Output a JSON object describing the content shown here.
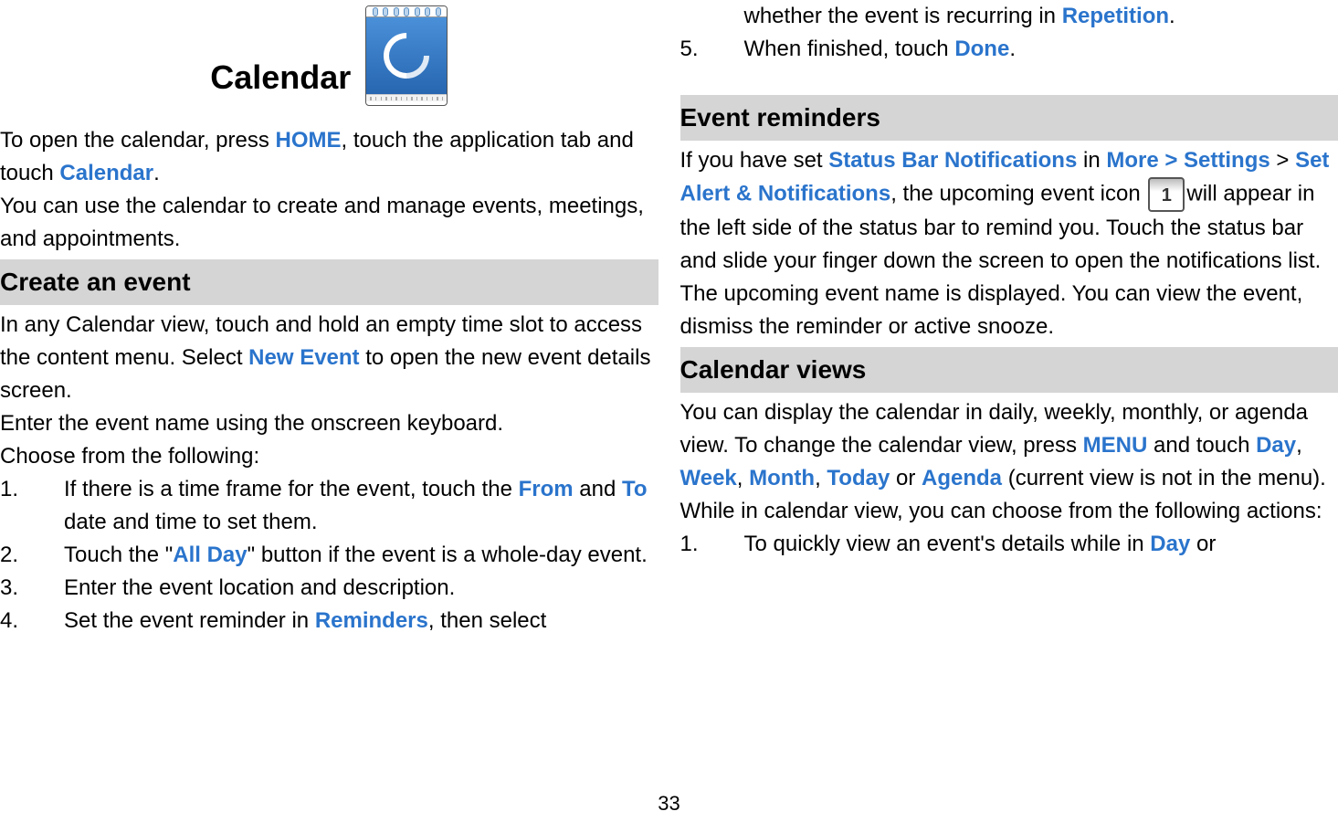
{
  "page_number": "33",
  "left": {
    "title": "Calendar",
    "intro1_pre": "To open the calendar, press ",
    "intro1_home": "HOME",
    "intro1_mid": ", touch the application tab and touch ",
    "intro1_calendar": "Calendar",
    "intro1_end": ".",
    "intro2": "You can use the calendar to create and manage events, meetings, and appointments.",
    "section1_title": "Create an event",
    "section1_p1_pre": "In any Calendar view, touch and hold an empty time slot to access the content menu.    Select ",
    "section1_p1_newevent": "New Event",
    "section1_p1_post": " to open the new event details screen.",
    "section1_p2": "Enter the event name using the onscreen keyboard.",
    "section1_p3": "Choose from the following:",
    "li1_pre": "If there is a time frame for the event, touch the ",
    "li1_from": "From",
    "li1_and": " and ",
    "li1_to": "To",
    "li1_post": " date and time to set them.",
    "li2_pre": "Touch the \"",
    "li2_allday": "All Day",
    "li2_post": "\" button if the event is a whole-day event.",
    "li3": "Enter the event location and description.",
    "li4_pre": "Set the event reminder in ",
    "li4_rem": "Reminders",
    "li4_post": ", then select "
  },
  "right": {
    "li4_cont_pre": "whether the event is recurring in ",
    "li4_cont_rep": "Repetition",
    "li4_cont_end": ".",
    "li5_pre": "When finished, touch ",
    "li5_done": "Done",
    "li5_end": ".",
    "section2_title": "Event reminders",
    "s2_p1_pre": "If you have set ",
    "s2_p1_sbn": "Status Bar Notifications",
    "s2_p1_in": " in ",
    "s2_p1_more": "More > Settings",
    "s2_p1_gt": " > ",
    "s2_p1_san": "Set Alert & Notifications",
    "s2_p1_mid1": ", the upcoming event icon ",
    "s2_p1_iconnum": "1",
    "s2_p1_post": "will appear in the left side of the status bar to remind you. Touch the status bar and slide your finger down the screen to open the notifications list. The upcoming event name is displayed. You can view the event, dismiss the reminder or active snooze.",
    "section3_title": "Calendar views",
    "s3_p1_pre": "You can display the calendar in daily, weekly, monthly, or agenda view. To change the calendar view, press ",
    "s3_p1_menu": "MENU",
    "s3_p1_andtouch": " and touch ",
    "s3_p1_day": "Day",
    "s3_p1_c1": ", ",
    "s3_p1_week": "Week",
    "s3_p1_c2": ", ",
    "s3_p1_month": "Month",
    "s3_p1_c3": ", ",
    "s3_p1_today": "Today",
    "s3_p1_or": " or ",
    "s3_p1_agenda": "Agenda",
    "s3_p1_post": " (current view is not in the menu).",
    "s3_p2": "While in calendar view, you can choose from the following actions:",
    "s3_li1_pre": "To quickly view an event's details while in ",
    "s3_li1_day": "Day",
    "s3_li1_or": " or "
  }
}
